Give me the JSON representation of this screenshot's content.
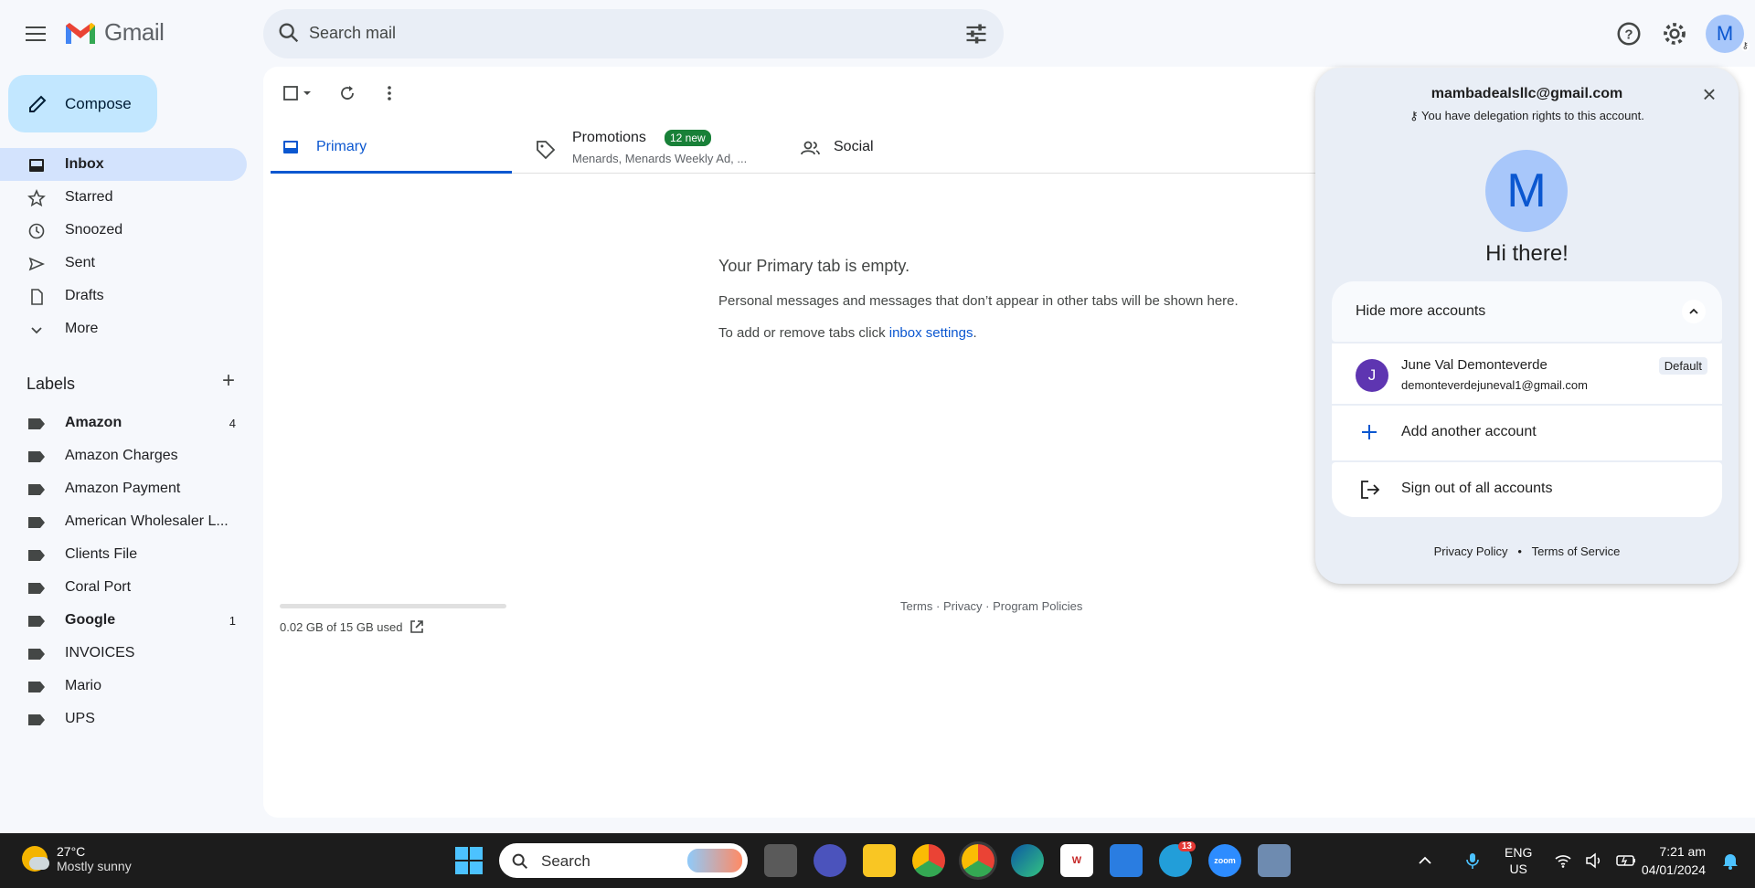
{
  "header": {
    "logo_text": "Gmail",
    "search_placeholder": "Search mail",
    "avatar_letter": "M"
  },
  "sidebar": {
    "compose_label": "Compose",
    "items": [
      {
        "label": "Inbox",
        "icon": "inbox-icon",
        "active": true
      },
      {
        "label": "Starred",
        "icon": "star-icon"
      },
      {
        "label": "Snoozed",
        "icon": "clock-icon"
      },
      {
        "label": "Sent",
        "icon": "send-icon"
      },
      {
        "label": "Drafts",
        "icon": "draft-icon"
      },
      {
        "label": "More",
        "icon": "chevron-down-icon"
      }
    ],
    "labels_title": "Labels",
    "labels": [
      {
        "label": "Amazon",
        "count": "4",
        "bold": true
      },
      {
        "label": "Amazon Charges",
        "count": ""
      },
      {
        "label": "Amazon Payment",
        "count": ""
      },
      {
        "label": "American Wholesaler L...",
        "count": ""
      },
      {
        "label": "Clients File",
        "count": ""
      },
      {
        "label": "Coral Port",
        "count": ""
      },
      {
        "label": "Google",
        "count": "1",
        "bold": true
      },
      {
        "label": "INVOICES",
        "count": ""
      },
      {
        "label": "Mario",
        "count": ""
      },
      {
        "label": "UPS",
        "count": ""
      }
    ]
  },
  "tabs": {
    "primary": "Primary",
    "promotions": "Promotions",
    "promotions_badge": "12 new",
    "promotions_sub": "Menards, Menards Weekly Ad, ...",
    "social": "Social"
  },
  "empty": {
    "title": "Your Primary tab is empty.",
    "body": "Personal messages and messages that don’t appear in other tabs will be shown here.",
    "settings_prefix": "To add or remove tabs click ",
    "settings_link": "inbox settings",
    "settings_suffix": "."
  },
  "storage": {
    "text": "0.02 GB of 15 GB used",
    "fraction": 0.0013
  },
  "footer": {
    "links": "Terms · Privacy · Program Policies"
  },
  "account_panel": {
    "email": "mambadealsllc@gmail.com",
    "delegation": "You have delegation rights to this account.",
    "avatar_letter": "M",
    "greeting": "Hi there!",
    "hide_accounts": "Hide more accounts",
    "other_account": {
      "initial": "J",
      "name": "June Val Demonteverde",
      "email": "demonteverdejuneval1@gmail.com",
      "badge": "Default"
    },
    "add_account": "Add another account",
    "sign_out": "Sign out of all accounts",
    "privacy": "Privacy Policy",
    "terms": "Terms of Service",
    "separator": "•"
  },
  "taskbar": {
    "weather_temp": "27°C",
    "weather_desc": "Mostly sunny",
    "search_label": "Search",
    "telegram_badge": "13",
    "zoom_label": "zoom",
    "lang_1": "ENG",
    "lang_2": "US",
    "time": "7:21 am",
    "date": "04/01/2024"
  },
  "colors": {
    "accent": "#0b57d0",
    "compose_bg": "#c2e7ff",
    "active_nav": "#d3e3fd",
    "promo_badge": "#188038",
    "panel_bg": "#e9eef6",
    "taskbar_bg": "#1c1c1c"
  }
}
